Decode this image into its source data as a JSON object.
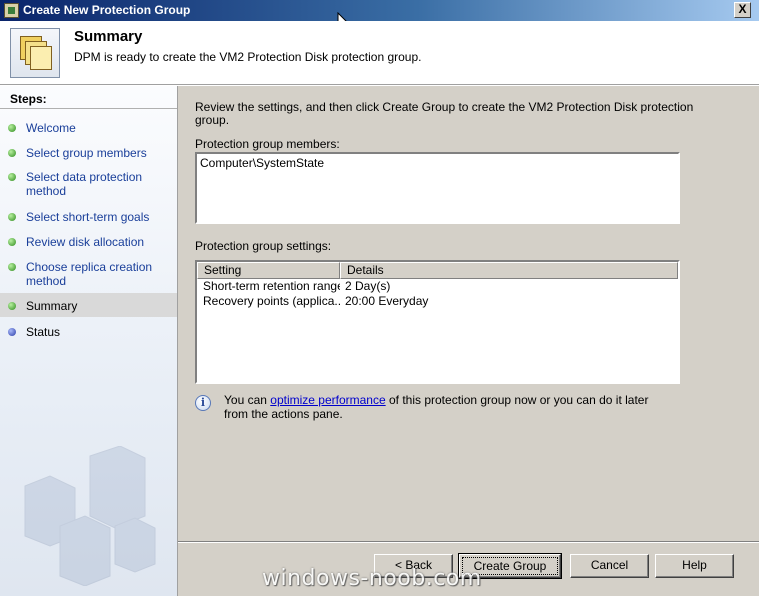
{
  "window": {
    "title": "Create New Protection Group",
    "close_glyph": "X"
  },
  "header": {
    "title": "Summary",
    "subtitle": "DPM is ready to create the VM2 Protection Disk protection group."
  },
  "sidebar": {
    "steps_label": "Steps:",
    "items": [
      {
        "label": "Welcome"
      },
      {
        "label": "Select group members"
      },
      {
        "label": "Select data protection method"
      },
      {
        "label": "Select short-term goals"
      },
      {
        "label": "Review disk allocation"
      },
      {
        "label": "Choose replica creation method"
      },
      {
        "label": "Summary"
      },
      {
        "label": "Status"
      }
    ]
  },
  "main": {
    "review_text": "Review the settings, and then click Create Group to create the VM2 Protection Disk protection group.",
    "members_label": "Protection group members:",
    "members": [
      "Computer\\SystemState"
    ],
    "settings_label": "Protection group settings:",
    "columns": {
      "setting": "Setting",
      "details": "Details"
    },
    "settings": [
      {
        "setting": "Short-term retention range",
        "details": "2 Day(s)"
      },
      {
        "setting": "Recovery points (applica...",
        "details": "20:00 Everyday"
      }
    ],
    "info": {
      "prefix": "You can ",
      "link": "optimize performance",
      "suffix": " of this protection group now or you can do it later from the actions pane."
    }
  },
  "buttons": {
    "back": "< Back",
    "create": "Create Group",
    "cancel": "Cancel",
    "help": "Help"
  },
  "watermark": "windows-noob.com",
  "icons": {
    "app": "dpm-app-icon",
    "wizard": "protection-group-icon",
    "completed_step": "green-bullet-icon",
    "pending_step": "blue-bullet-icon",
    "info": "info-icon"
  }
}
